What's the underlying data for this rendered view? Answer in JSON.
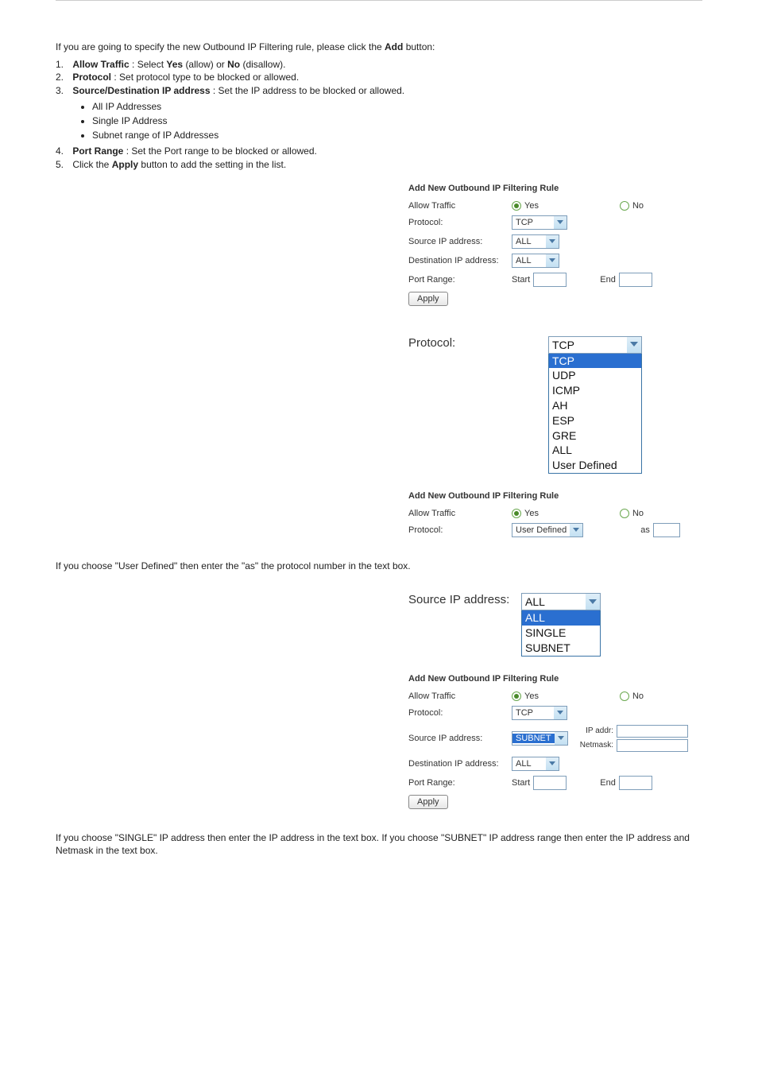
{
  "intro": {
    "line1_prefix": "If you are going to specify the new Outbound IP Filtering rule, please click the ",
    "line1_bold": "Add",
    "line1_suffix": " button:",
    "step1_num": "1.",
    "step1_a": "Allow Traffic",
    "step1_b": ": Select ",
    "step1_c": "Yes",
    "step1_d": " (allow) or ",
    "step1_e": "No",
    "step1_f": " (disallow).",
    "step2_num": "2.",
    "step2_a": "Protocol",
    "step2_b": ": Set protocol type to be blocked or allowed.",
    "step3_num": "3.",
    "step3_a": "Source/Destination IP address",
    "step3_b": ": Set the IP address to be blocked or allowed.",
    "step3_bullets": [
      "All IP Addresses",
      "Single IP Address",
      "Subnet range of IP Addresses"
    ],
    "step4_num": "4.",
    "step4_a": "Port Range",
    "step4_b": ": Set the Port range to be blocked or allowed.",
    "step5_num": "5.",
    "step5_a": "Click the ",
    "step5_b": "Apply",
    "step5_c": " button to add the setting in the list."
  },
  "panel1": {
    "title": "Add New Outbound IP Filtering Rule",
    "allow_label": "Allow Traffic",
    "yes": "Yes",
    "no": "No",
    "protocol_label": "Protocol:",
    "protocol_value": "TCP",
    "srcip_label": "Source IP address:",
    "srcip_value": "ALL",
    "dstip_label": "Destination IP address:",
    "dstip_value": "ALL",
    "port_label": "Port Range:",
    "start": "Start",
    "end": "End",
    "apply": "Apply"
  },
  "fig_protocol": {
    "label": "Protocol:",
    "selected": "TCP",
    "options": [
      "TCP",
      "UDP",
      "ICMP",
      "AH",
      "ESP",
      "GRE",
      "ALL",
      "User Defined"
    ]
  },
  "panel2": {
    "title": "Add New Outbound IP Filtering Rule",
    "allow_label": "Allow Traffic",
    "yes": "Yes",
    "no": "No",
    "protocol_label": "Protocol:",
    "protocol_value": "User Defined",
    "as": "as"
  },
  "intro2": "If you choose \"User Defined\" then enter the \"as\" the protocol number in the text box.",
  "fig_srcip": {
    "label": "Source IP address:",
    "selected": "ALL",
    "options": [
      "ALL",
      "SINGLE",
      "SUBNET"
    ]
  },
  "panel3": {
    "title": "Add New Outbound IP Filtering Rule",
    "allow_label": "Allow Traffic",
    "yes": "Yes",
    "no": "No",
    "protocol_label": "Protocol:",
    "protocol_value": "TCP",
    "srcip_label": "Source IP address:",
    "srcip_value": "SUBNET",
    "ipaddr_label": "IP addr:",
    "netmask_label": "Netmask:",
    "dstip_label": "Destination IP address:",
    "dstip_value": "ALL",
    "port_label": "Port Range:",
    "start": "Start",
    "end": "End",
    "apply": "Apply"
  },
  "intro3": {
    "line_a": "If you choose \"SINGLE\" IP address then enter the IP address in the text box. If you choose \"SUBNET\" IP address range then enter the IP address and Netmask in the text box."
  }
}
